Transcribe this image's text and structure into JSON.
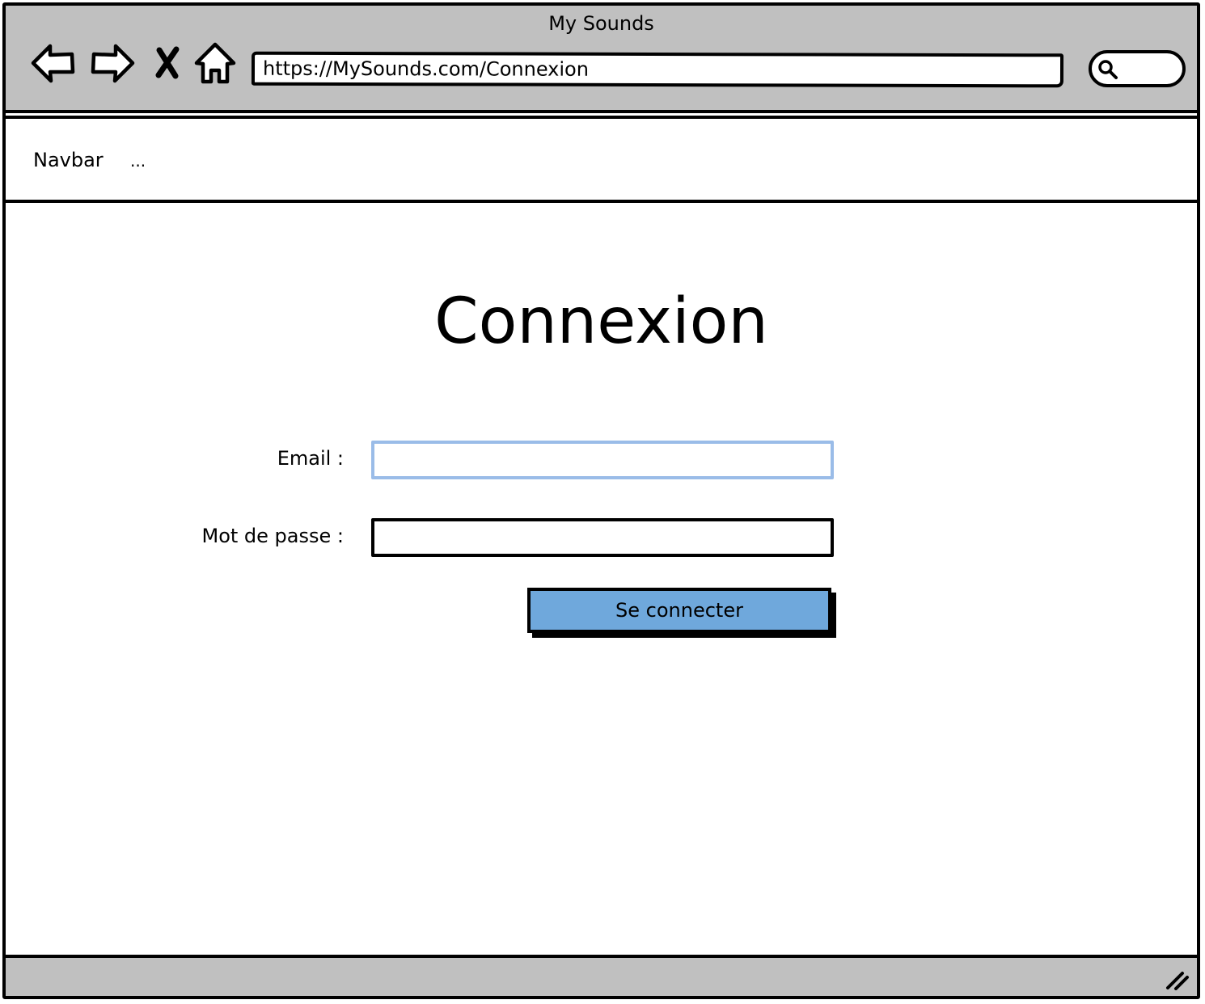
{
  "window": {
    "title": "My Sounds"
  },
  "toolbar": {
    "back_icon": "back-arrow-icon",
    "forward_icon": "forward-arrow-icon",
    "stop_icon": "close-x-icon",
    "home_icon": "home-icon",
    "url": "https://MySounds.com/Connexion",
    "search_icon": "search-icon"
  },
  "navbar": {
    "label": "Navbar",
    "more": "..."
  },
  "main": {
    "heading": "Connexion",
    "form": {
      "email_label": "Email :",
      "email_value": "",
      "password_label": "Mot de passe :",
      "password_value": "",
      "submit_label": "Se connecter"
    }
  },
  "colors": {
    "chrome_gray": "#c0c0c0",
    "button_blue": "#6fa8dc",
    "focus_blue": "#9abce8"
  }
}
